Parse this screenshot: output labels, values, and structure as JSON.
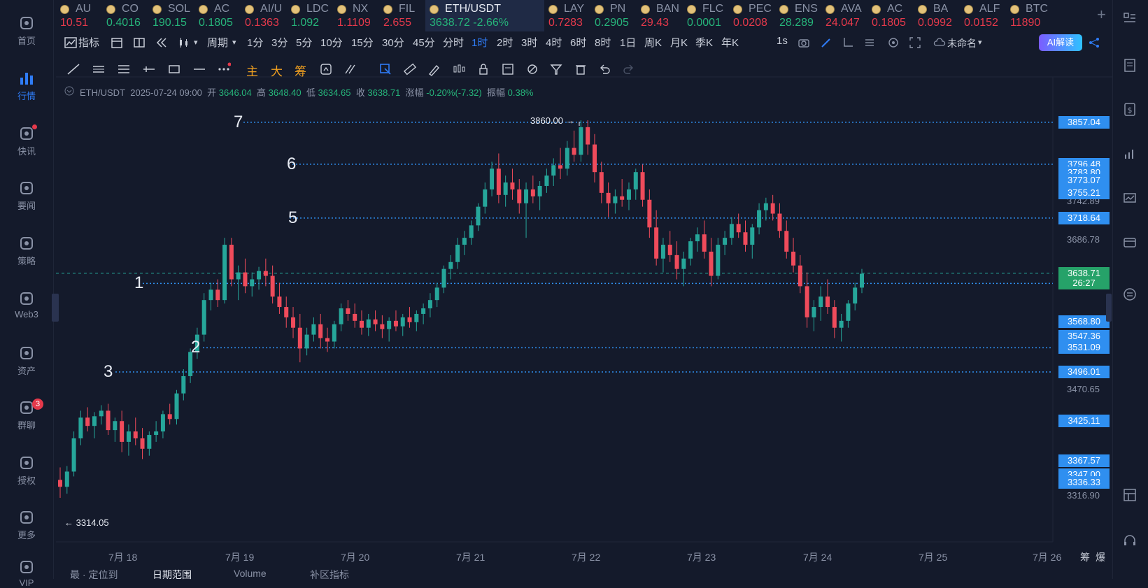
{
  "nav": [
    {
      "label": "首页",
      "icon": "home-icon"
    },
    {
      "label": "行情",
      "icon": "market-chart-icon",
      "active": true
    },
    {
      "label": "快讯",
      "icon": "news-flash-icon"
    },
    {
      "label": "要闻",
      "icon": "headline-icon"
    },
    {
      "label": "策略",
      "icon": "robot-strategy-icon"
    },
    {
      "label": "Web3",
      "icon": "web3-icon"
    },
    {
      "label": "资产",
      "icon": "wallet-icon"
    },
    {
      "label": "群聊",
      "icon": "chat-icon",
      "badge": "3"
    },
    {
      "label": "授权",
      "icon": "key-icon"
    },
    {
      "label": "更多",
      "icon": "grid-more-icon"
    },
    {
      "label": "VIP",
      "icon": "vip-icon"
    }
  ],
  "tickers": [
    {
      "name": "AU",
      "price": "10.51",
      "dir": "dn"
    },
    {
      "name": "CO",
      "price": "0.4016",
      "dir": "up"
    },
    {
      "name": "SOL",
      "price": "190.15",
      "dir": "up"
    },
    {
      "name": "AC",
      "price": "0.1805",
      "dir": "up"
    },
    {
      "name": "AI/U",
      "price": "0.1363",
      "dir": "dn"
    },
    {
      "name": "LDC",
      "price": "1.092",
      "dir": "up"
    },
    {
      "name": "NX",
      "price": "1.1109",
      "dir": "dn"
    },
    {
      "name": "FIL",
      "price": "2.655",
      "dir": "dn"
    },
    {
      "name": "ETH/USDT",
      "price": "3638.72  -2.66%",
      "dir": "up",
      "selected": true
    },
    {
      "name": "LAY",
      "price": "0.7283",
      "dir": "dn"
    },
    {
      "name": "PN",
      "price": "0.2905",
      "dir": "up"
    },
    {
      "name": "BAN",
      "price": "29.43",
      "dir": "dn"
    },
    {
      "name": "FLC",
      "price": "0.0001",
      "dir": "up"
    },
    {
      "name": "PEC",
      "price": "0.0208",
      "dir": "dn"
    },
    {
      "name": "ENS",
      "price": "28.289",
      "dir": "up"
    },
    {
      "name": "AVA",
      "price": "24.047",
      "dir": "dn"
    },
    {
      "name": "AC",
      "price": "0.1805",
      "dir": "dn"
    },
    {
      "name": "BA",
      "price": "0.0992",
      "dir": "dn"
    },
    {
      "name": "ALF",
      "price": "0.0152",
      "dir": "dn"
    },
    {
      "name": "BTC",
      "price": "11890",
      "dir": "dn"
    }
  ],
  "toolbar": {
    "indicator": "指标",
    "period": "周期",
    "periods": [
      "1分",
      "3分",
      "5分",
      "10分",
      "15分",
      "30分",
      "45分",
      "分时",
      "1时",
      "2时",
      "3时",
      "4时",
      "6时",
      "8时",
      "1日",
      "周K",
      "月K",
      "季K",
      "年K"
    ],
    "active_period": "1时",
    "interval": "1s",
    "layout_name": "未命名",
    "ai_label": "AI解读"
  },
  "draw_tools": {
    "main": "主",
    "big": "大",
    "chip": "筹"
  },
  "info": {
    "symbol": "ETH/USDT",
    "datetime": "2025-07-24 09:00",
    "open_label": "开",
    "open": "3646.04",
    "high_label": "高",
    "high": "3648.40",
    "low_label": "低",
    "low": "3634.65",
    "close_label": "收",
    "close": "3638.71",
    "chg_label": "涨幅",
    "chg": "-0.20%(-7.32)",
    "amp_label": "振幅",
    "amp": "0.38%"
  },
  "price_axis": {
    "labels": [
      "3742.89",
      "3686.78",
      "3470.65",
      "3316.90"
    ],
    "tags": [
      {
        "text": "3857.04",
        "price": 3857.04
      },
      {
        "text": "3796.48",
        "price": 3796.48
      },
      {
        "text": "3783.80",
        "price": 3783.8
      },
      {
        "text": "3773.07",
        "price": 3773.07
      },
      {
        "text": "3755.21",
        "price": 3755.21
      },
      {
        "text": "3718.64",
        "price": 3718.64
      },
      {
        "text": "3638.71",
        "price": 3638.71,
        "color": "green"
      },
      {
        "text": "26:27",
        "price": 3624.0,
        "color": "green"
      },
      {
        "text": "3568.80",
        "price": 3568.8
      },
      {
        "text": "3547.36",
        "price": 3547.36
      },
      {
        "text": "3531.09",
        "price": 3531.09
      },
      {
        "text": "3496.01",
        "price": 3496.01
      },
      {
        "text": "3425.11",
        "price": 3425.11
      },
      {
        "text": "3367.57",
        "price": 3367.57
      },
      {
        "text": "3347.00",
        "price": 3347.0
      },
      {
        "text": "3336.33",
        "price": 3336.33
      }
    ]
  },
  "levels": [
    {
      "label": "7",
      "price": 3857.04
    },
    {
      "label": "6",
      "price": 3796.48
    },
    {
      "label": "5",
      "price": 3718.64
    },
    {
      "label": "1",
      "price": 3624.0
    },
    {
      "label": "2",
      "price": 3531.09
    },
    {
      "label": "3",
      "price": 3496.01
    }
  ],
  "extremes": {
    "high": "3860.00 →",
    "low": "← 3314.05"
  },
  "dates": [
    "7月 18",
    "7月 19",
    "7月 20",
    "7月 21",
    "7月 22",
    "7月 23",
    "7月 24",
    "7月 25",
    "7月 26"
  ],
  "axis_corner": [
    "筹",
    "爆"
  ],
  "bottom_tabs": [
    "最 · 定位到",
    "日期范围",
    "Volume",
    "补区指标"
  ],
  "chart_data": {
    "type": "candlestick",
    "symbol": "ETH/USDT",
    "interval": "1h",
    "ylim": [
      3300,
      3880
    ],
    "high_marker": 3860.0,
    "low_marker": 3314.05,
    "last_price": 3638.71,
    "colors": {
      "up": "#26a69a",
      "down": "#ef4b5b"
    },
    "candles": [
      [
        3340,
        3358,
        3314,
        3330
      ],
      [
        3330,
        3360,
        3320,
        3352
      ],
      [
        3352,
        3410,
        3345,
        3400
      ],
      [
        3400,
        3440,
        3390,
        3430
      ],
      [
        3430,
        3445,
        3410,
        3418
      ],
      [
        3418,
        3438,
        3400,
        3432
      ],
      [
        3432,
        3448,
        3420,
        3440
      ],
      [
        3440,
        3450,
        3405,
        3412
      ],
      [
        3412,
        3430,
        3395,
        3425
      ],
      [
        3425,
        3440,
        3380,
        3395
      ],
      [
        3395,
        3420,
        3375,
        3410
      ],
      [
        3410,
        3430,
        3390,
        3400
      ],
      [
        3400,
        3415,
        3370,
        3385
      ],
      [
        3385,
        3410,
        3375,
        3405
      ],
      [
        3405,
        3425,
        3395,
        3410
      ],
      [
        3410,
        3440,
        3400,
        3435
      ],
      [
        3435,
        3450,
        3420,
        3428
      ],
      [
        3428,
        3470,
        3420,
        3465
      ],
      [
        3465,
        3500,
        3455,
        3490
      ],
      [
        3490,
        3530,
        3480,
        3525
      ],
      [
        3525,
        3560,
        3515,
        3550
      ],
      [
        3550,
        3610,
        3540,
        3600
      ],
      [
        3600,
        3625,
        3585,
        3615
      ],
      [
        3615,
        3630,
        3590,
        3600
      ],
      [
        3600,
        3690,
        3595,
        3680
      ],
      [
        3680,
        3690,
        3620,
        3630
      ],
      [
        3630,
        3650,
        3600,
        3640
      ],
      [
        3640,
        3660,
        3610,
        3620
      ],
      [
        3620,
        3640,
        3605,
        3630
      ],
      [
        3630,
        3648,
        3615,
        3642
      ],
      [
        3642,
        3660,
        3620,
        3635
      ],
      [
        3635,
        3650,
        3595,
        3605
      ],
      [
        3605,
        3625,
        3580,
        3590
      ],
      [
        3590,
        3605,
        3560,
        3575
      ],
      [
        3575,
        3590,
        3545,
        3560
      ],
      [
        3560,
        3580,
        3510,
        3530
      ],
      [
        3530,
        3560,
        3520,
        3550
      ],
      [
        3550,
        3575,
        3540,
        3565
      ],
      [
        3565,
        3580,
        3530,
        3545
      ],
      [
        3545,
        3560,
        3525,
        3540
      ],
      [
        3540,
        3570,
        3530,
        3565
      ],
      [
        3565,
        3595,
        3555,
        3588
      ],
      [
        3588,
        3600,
        3570,
        3580
      ],
      [
        3580,
        3595,
        3560,
        3570
      ],
      [
        3570,
        3585,
        3550,
        3560
      ],
      [
        3560,
        3580,
        3548,
        3572
      ],
      [
        3572,
        3585,
        3555,
        3565
      ],
      [
        3565,
        3578,
        3545,
        3558
      ],
      [
        3558,
        3575,
        3540,
        3570
      ],
      [
        3570,
        3585,
        3555,
        3562
      ],
      [
        3562,
        3580,
        3548,
        3575
      ],
      [
        3575,
        3590,
        3560,
        3568
      ],
      [
        3568,
        3585,
        3555,
        3580
      ],
      [
        3580,
        3595,
        3565,
        3588
      ],
      [
        3588,
        3610,
        3575,
        3600
      ],
      [
        3600,
        3625,
        3590,
        3618
      ],
      [
        3618,
        3650,
        3610,
        3645
      ],
      [
        3645,
        3665,
        3630,
        3655
      ],
      [
        3655,
        3690,
        3645,
        3680
      ],
      [
        3680,
        3700,
        3665,
        3690
      ],
      [
        3690,
        3715,
        3680,
        3708
      ],
      [
        3708,
        3740,
        3700,
        3735
      ],
      [
        3735,
        3770,
        3725,
        3760
      ],
      [
        3760,
        3800,
        3750,
        3790
      ],
      [
        3790,
        3812,
        3740,
        3752
      ],
      [
        3752,
        3780,
        3735,
        3770
      ],
      [
        3770,
        3790,
        3745,
        3760
      ],
      [
        3760,
        3775,
        3725,
        3740
      ],
      [
        3740,
        3770,
        3690,
        3760
      ],
      [
        3760,
        3780,
        3740,
        3750
      ],
      [
        3750,
        3772,
        3730,
        3765
      ],
      [
        3765,
        3790,
        3755,
        3780
      ],
      [
        3780,
        3805,
        3765,
        3795
      ],
      [
        3795,
        3820,
        3775,
        3790
      ],
      [
        3790,
        3830,
        3780,
        3820
      ],
      [
        3820,
        3845,
        3800,
        3810
      ],
      [
        3810,
        3860,
        3800,
        3850
      ],
      [
        3850,
        3860,
        3810,
        3825
      ],
      [
        3825,
        3840,
        3770,
        3785
      ],
      [
        3785,
        3800,
        3740,
        3755
      ],
      [
        3755,
        3770,
        3720,
        3740
      ],
      [
        3740,
        3760,
        3725,
        3750
      ],
      [
        3750,
        3775,
        3735,
        3745
      ],
      [
        3745,
        3770,
        3730,
        3760
      ],
      [
        3760,
        3790,
        3745,
        3785
      ],
      [
        3785,
        3796,
        3735,
        3745
      ],
      [
        3745,
        3760,
        3690,
        3705
      ],
      [
        3705,
        3730,
        3650,
        3660
      ],
      [
        3660,
        3690,
        3640,
        3680
      ],
      [
        3680,
        3700,
        3655,
        3665
      ],
      [
        3665,
        3685,
        3630,
        3645
      ],
      [
        3645,
        3670,
        3620,
        3660
      ],
      [
        3660,
        3690,
        3650,
        3685
      ],
      [
        3685,
        3705,
        3670,
        3695
      ],
      [
        3695,
        3715,
        3660,
        3670
      ],
      [
        3670,
        3690,
        3620,
        3635
      ],
      [
        3635,
        3690,
        3630,
        3680
      ],
      [
        3680,
        3700,
        3665,
        3690
      ],
      [
        3690,
        3720,
        3680,
        3710
      ],
      [
        3710,
        3725,
        3690,
        3698
      ],
      [
        3698,
        3715,
        3670,
        3680
      ],
      [
        3680,
        3710,
        3660,
        3705
      ],
      [
        3705,
        3740,
        3695,
        3730
      ],
      [
        3730,
        3748,
        3715,
        3740
      ],
      [
        3740,
        3752,
        3715,
        3725
      ],
      [
        3725,
        3740,
        3690,
        3700
      ],
      [
        3700,
        3715,
        3660,
        3670
      ],
      [
        3670,
        3690,
        3640,
        3650
      ],
      [
        3650,
        3665,
        3610,
        3620
      ],
      [
        3620,
        3640,
        3560,
        3575
      ],
      [
        3575,
        3600,
        3555,
        3590
      ],
      [
        3590,
        3620,
        3570,
        3605
      ],
      [
        3605,
        3630,
        3580,
        3590
      ],
      [
        3590,
        3600,
        3545,
        3560
      ],
      [
        3560,
        3580,
        3540,
        3570
      ],
      [
        3570,
        3600,
        3560,
        3595
      ],
      [
        3595,
        3625,
        3585,
        3618
      ],
      [
        3618,
        3645,
        3610,
        3638
      ]
    ]
  }
}
